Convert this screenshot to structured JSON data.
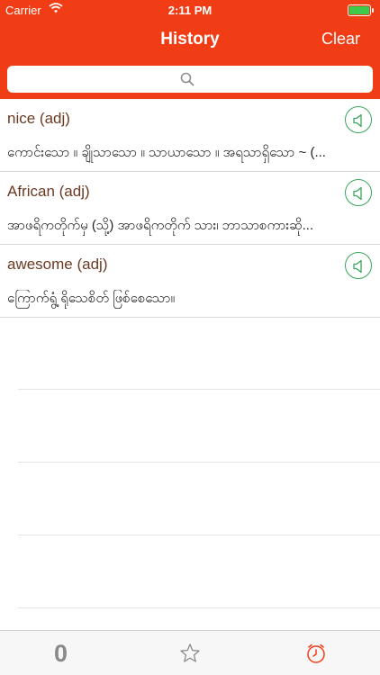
{
  "status": {
    "carrier": "Carrier",
    "time": "2:11 PM"
  },
  "nav": {
    "title": "History",
    "clear_label": "Clear"
  },
  "search": {
    "placeholder": ""
  },
  "history": [
    {
      "word": "nice (adj)",
      "definition": "ကောင်းသော ။ ချိုသာသော ။ သာယာသော ။ အရသာရှိသော ~ (..."
    },
    {
      "word": "African (adj)",
      "definition": "အာဖရိကတိုက်မှ (သို့) အာဖရိကတိုက် သား၊ ဘာသာစကားဆို..."
    },
    {
      "word": "awesome (adj)",
      "definition": "ကြောက်ရွံ့ ရိုသေစိတ် ဖြစ်စေသော။"
    }
  ],
  "tabs": {
    "first_label": "0"
  },
  "colors": {
    "accent": "#f03d16",
    "speaker": "#3aa65c",
    "word_text": "#6b3a22",
    "selected_tab": "#f03d16"
  },
  "icons": [
    "wifi-icon",
    "battery-icon",
    "search-icon",
    "speaker-icon",
    "star-icon",
    "clock-icon"
  ]
}
